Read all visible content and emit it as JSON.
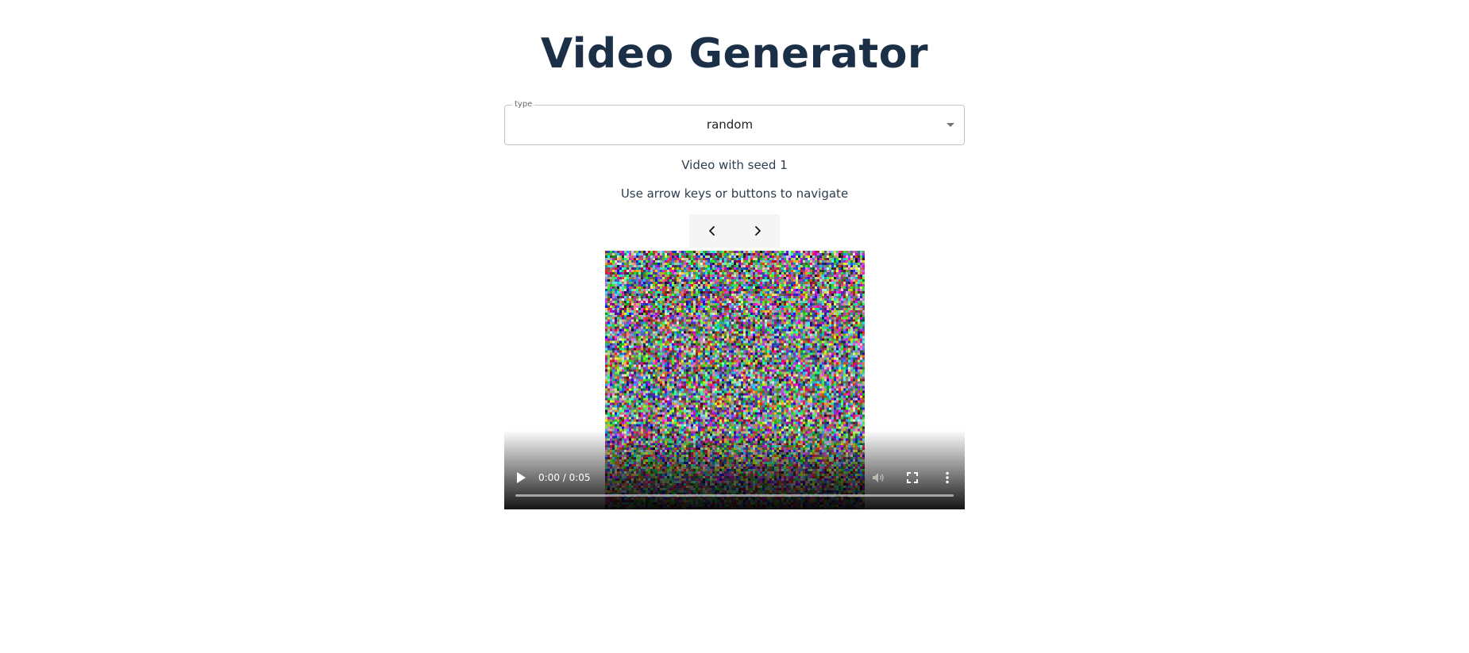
{
  "page": {
    "title": "Video Generator"
  },
  "type_select": {
    "label": "type",
    "value": "random"
  },
  "info": {
    "seed_text": "Video with seed 1",
    "hint_text": "Use arrow keys or buttons to navigate"
  },
  "nav": {
    "prev_icon": "chevron-left-icon",
    "next_icon": "chevron-right-icon"
  },
  "player": {
    "time_display": "0:00 / 0:05",
    "progress": 0,
    "play_icon": "play-icon",
    "volume_icon": "volume-icon",
    "fullscreen_icon": "fullscreen-icon",
    "more_icon": "more-vert-icon"
  }
}
